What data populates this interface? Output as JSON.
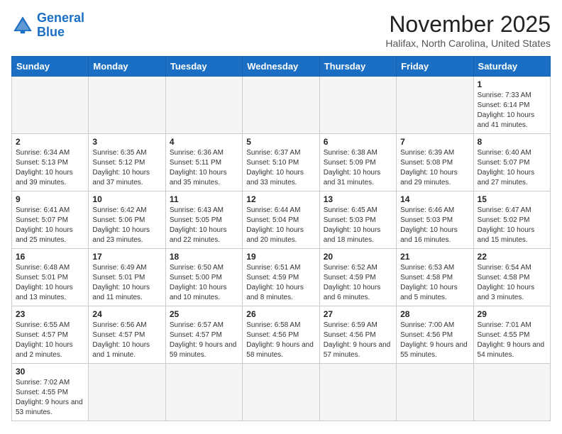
{
  "header": {
    "logo_general": "General",
    "logo_blue": "Blue",
    "month": "November 2025",
    "location": "Halifax, North Carolina, United States"
  },
  "weekdays": [
    "Sunday",
    "Monday",
    "Tuesday",
    "Wednesday",
    "Thursday",
    "Friday",
    "Saturday"
  ],
  "days": [
    {
      "num": "",
      "info": ""
    },
    {
      "num": "",
      "info": ""
    },
    {
      "num": "",
      "info": ""
    },
    {
      "num": "",
      "info": ""
    },
    {
      "num": "",
      "info": ""
    },
    {
      "num": "",
      "info": ""
    },
    {
      "num": "1",
      "info": "Sunrise: 7:33 AM\nSunset: 6:14 PM\nDaylight: 10 hours and 41 minutes."
    },
    {
      "num": "2",
      "info": "Sunrise: 6:34 AM\nSunset: 5:13 PM\nDaylight: 10 hours and 39 minutes."
    },
    {
      "num": "3",
      "info": "Sunrise: 6:35 AM\nSunset: 5:12 PM\nDaylight: 10 hours and 37 minutes."
    },
    {
      "num": "4",
      "info": "Sunrise: 6:36 AM\nSunset: 5:11 PM\nDaylight: 10 hours and 35 minutes."
    },
    {
      "num": "5",
      "info": "Sunrise: 6:37 AM\nSunset: 5:10 PM\nDaylight: 10 hours and 33 minutes."
    },
    {
      "num": "6",
      "info": "Sunrise: 6:38 AM\nSunset: 5:09 PM\nDaylight: 10 hours and 31 minutes."
    },
    {
      "num": "7",
      "info": "Sunrise: 6:39 AM\nSunset: 5:08 PM\nDaylight: 10 hours and 29 minutes."
    },
    {
      "num": "8",
      "info": "Sunrise: 6:40 AM\nSunset: 5:07 PM\nDaylight: 10 hours and 27 minutes."
    },
    {
      "num": "9",
      "info": "Sunrise: 6:41 AM\nSunset: 5:07 PM\nDaylight: 10 hours and 25 minutes."
    },
    {
      "num": "10",
      "info": "Sunrise: 6:42 AM\nSunset: 5:06 PM\nDaylight: 10 hours and 23 minutes."
    },
    {
      "num": "11",
      "info": "Sunrise: 6:43 AM\nSunset: 5:05 PM\nDaylight: 10 hours and 22 minutes."
    },
    {
      "num": "12",
      "info": "Sunrise: 6:44 AM\nSunset: 5:04 PM\nDaylight: 10 hours and 20 minutes."
    },
    {
      "num": "13",
      "info": "Sunrise: 6:45 AM\nSunset: 5:03 PM\nDaylight: 10 hours and 18 minutes."
    },
    {
      "num": "14",
      "info": "Sunrise: 6:46 AM\nSunset: 5:03 PM\nDaylight: 10 hours and 16 minutes."
    },
    {
      "num": "15",
      "info": "Sunrise: 6:47 AM\nSunset: 5:02 PM\nDaylight: 10 hours and 15 minutes."
    },
    {
      "num": "16",
      "info": "Sunrise: 6:48 AM\nSunset: 5:01 PM\nDaylight: 10 hours and 13 minutes."
    },
    {
      "num": "17",
      "info": "Sunrise: 6:49 AM\nSunset: 5:01 PM\nDaylight: 10 hours and 11 minutes."
    },
    {
      "num": "18",
      "info": "Sunrise: 6:50 AM\nSunset: 5:00 PM\nDaylight: 10 hours and 10 minutes."
    },
    {
      "num": "19",
      "info": "Sunrise: 6:51 AM\nSunset: 4:59 PM\nDaylight: 10 hours and 8 minutes."
    },
    {
      "num": "20",
      "info": "Sunrise: 6:52 AM\nSunset: 4:59 PM\nDaylight: 10 hours and 6 minutes."
    },
    {
      "num": "21",
      "info": "Sunrise: 6:53 AM\nSunset: 4:58 PM\nDaylight: 10 hours and 5 minutes."
    },
    {
      "num": "22",
      "info": "Sunrise: 6:54 AM\nSunset: 4:58 PM\nDaylight: 10 hours and 3 minutes."
    },
    {
      "num": "23",
      "info": "Sunrise: 6:55 AM\nSunset: 4:57 PM\nDaylight: 10 hours and 2 minutes."
    },
    {
      "num": "24",
      "info": "Sunrise: 6:56 AM\nSunset: 4:57 PM\nDaylight: 10 hours and 1 minute."
    },
    {
      "num": "25",
      "info": "Sunrise: 6:57 AM\nSunset: 4:57 PM\nDaylight: 9 hours and 59 minutes."
    },
    {
      "num": "26",
      "info": "Sunrise: 6:58 AM\nSunset: 4:56 PM\nDaylight: 9 hours and 58 minutes."
    },
    {
      "num": "27",
      "info": "Sunrise: 6:59 AM\nSunset: 4:56 PM\nDaylight: 9 hours and 57 minutes."
    },
    {
      "num": "28",
      "info": "Sunrise: 7:00 AM\nSunset: 4:56 PM\nDaylight: 9 hours and 55 minutes."
    },
    {
      "num": "29",
      "info": "Sunrise: 7:01 AM\nSunset: 4:55 PM\nDaylight: 9 hours and 54 minutes."
    },
    {
      "num": "30",
      "info": "Sunrise: 7:02 AM\nSunset: 4:55 PM\nDaylight: 9 hours and 53 minutes."
    },
    {
      "num": "",
      "info": ""
    },
    {
      "num": "",
      "info": ""
    },
    {
      "num": "",
      "info": ""
    },
    {
      "num": "",
      "info": ""
    },
    {
      "num": "",
      "info": ""
    },
    {
      "num": "",
      "info": ""
    }
  ]
}
